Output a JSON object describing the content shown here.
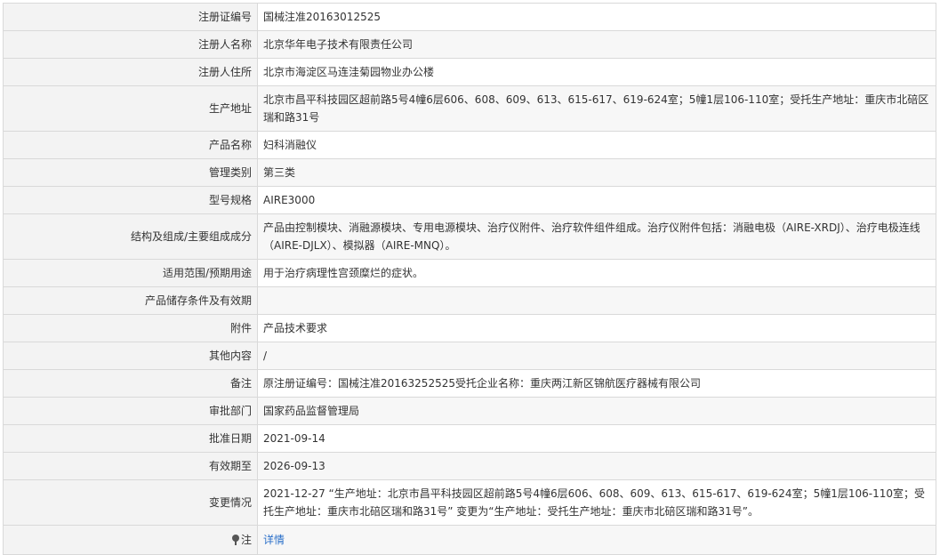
{
  "rows": [
    {
      "label": "注册证编号",
      "value": "国械注准20163012525"
    },
    {
      "label": "注册人名称",
      "value": "北京华年电子技术有限责任公司"
    },
    {
      "label": "注册人住所",
      "value": "北京市海淀区马连洼菊园物业办公楼"
    },
    {
      "label": "生产地址",
      "value": "北京市昌平科技园区超前路5号4幢6层606、608、609、613、615-617、619-624室；5幢1层106-110室；受托生产地址：重庆市北碚区瑞和路31号"
    },
    {
      "label": "产品名称",
      "value": "妇科消融仪"
    },
    {
      "label": "管理类别",
      "value": "第三类"
    },
    {
      "label": "型号规格",
      "value": "AIRE3000"
    },
    {
      "label": "结构及组成/主要组成成分",
      "value": "产品由控制模块、消融源模块、专用电源模块、治疗仪附件、治疗软件组件组成。治疗仪附件包括：消融电极（AIRE-XRDJ）、治疗电极连线（AIRE-DJLX）、模拟器（AIRE-MNQ）。"
    },
    {
      "label": "适用范围/预期用途",
      "value": "用于治疗病理性宫颈糜烂的症状。"
    },
    {
      "label": "产品储存条件及有效期",
      "value": ""
    },
    {
      "label": "附件",
      "value": "产品技术要求"
    },
    {
      "label": "其他内容",
      "value": "/"
    },
    {
      "label": "备注",
      "value": "原注册证编号：国械注准20163252525受托企业名称：重庆两江新区锦航医疗器械有限公司"
    },
    {
      "label": "审批部门",
      "value": "国家药品监督管理局"
    },
    {
      "label": "批准日期",
      "value": "2021-09-14"
    },
    {
      "label": "有效期至",
      "value": "2026-09-13"
    },
    {
      "label": "变更情况",
      "value": "2021-12-27 “生产地址：北京市昌平科技园区超前路5号4幢6层606、608、609、613、615-617、619-624室；5幢1层106-110室；受托生产地址：重庆市北碚区瑞和路31号” 变更为“生产地址：受托生产地址：重庆市北碚区瑞和路31号”。"
    }
  ],
  "note": {
    "label": "注",
    "link_text": "详情",
    "icon": "pin-icon"
  }
}
